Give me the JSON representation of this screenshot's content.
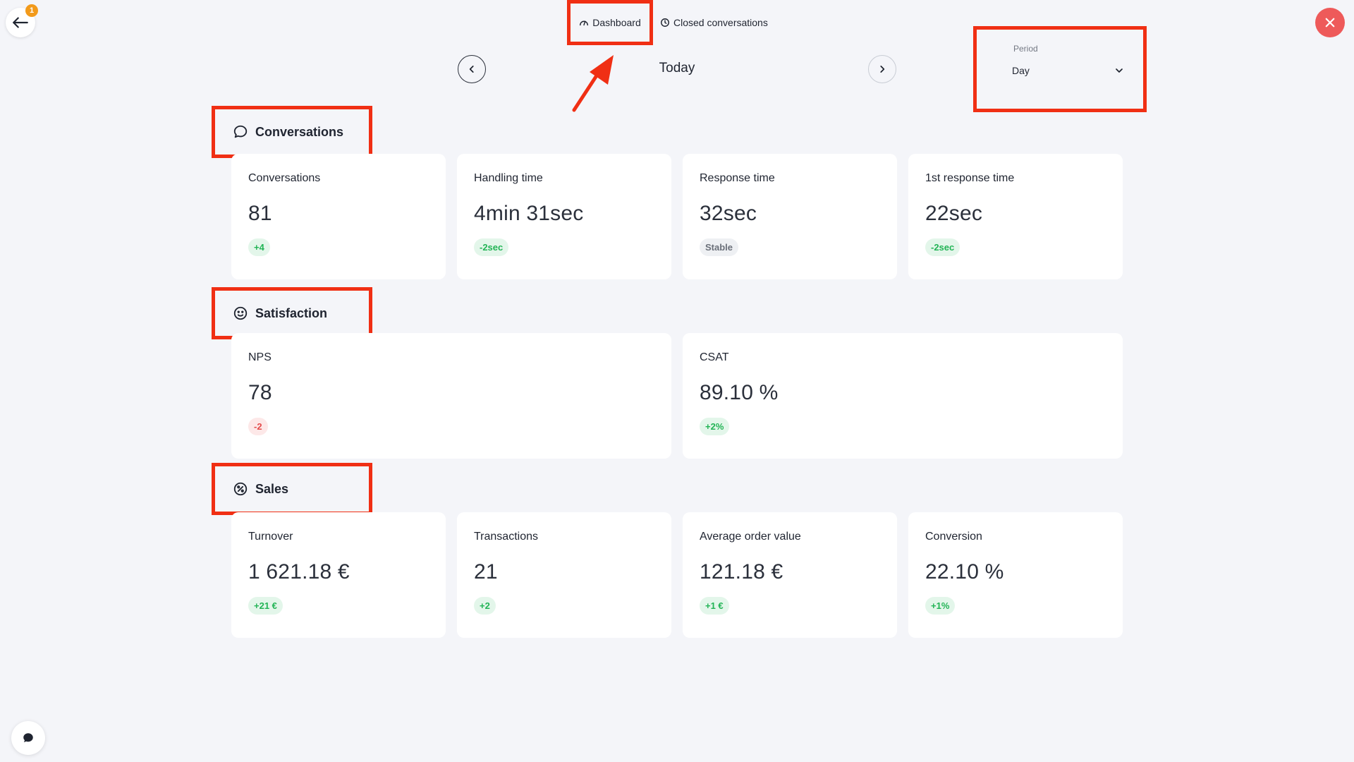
{
  "nav": {
    "notification_count": "1"
  },
  "tabs": [
    {
      "label": "Dashboard",
      "icon": "dashboard-gauge-icon",
      "active": true
    },
    {
      "label": "Closed conversations",
      "icon": "clock-icon",
      "active": false
    }
  ],
  "date_nav": {
    "label": "Today"
  },
  "period": {
    "label": "Period",
    "selected": "Day"
  },
  "sections": {
    "conversations": {
      "title": "Conversations",
      "icon": "chat-bubble-icon",
      "cards": [
        {
          "title": "Conversations",
          "value": "81",
          "delta": "+4",
          "trend": "positive"
        },
        {
          "title": "Handling time",
          "value": "4min 31sec",
          "delta": "-2sec",
          "trend": "positive"
        },
        {
          "title": "Response time",
          "value": "32sec",
          "delta": "Stable",
          "trend": "neutral"
        },
        {
          "title": "1st response time",
          "value": "22sec",
          "delta": "-2sec",
          "trend": "positive"
        }
      ]
    },
    "satisfaction": {
      "title": "Satisfaction",
      "icon": "smiley-icon",
      "cards": [
        {
          "title": "NPS",
          "value": "78",
          "delta": "-2",
          "trend": "negative"
        },
        {
          "title": "CSAT",
          "value": "89.10 %",
          "delta": "+2%",
          "trend": "positive"
        }
      ]
    },
    "sales": {
      "title": "Sales",
      "icon": "percent-icon",
      "cards": [
        {
          "title": "Turnover",
          "value": "1 621.18 €",
          "delta": "+21 €",
          "trend": "positive"
        },
        {
          "title": "Transactions",
          "value": "21",
          "delta": "+2",
          "trend": "positive"
        },
        {
          "title": "Average order value",
          "value": "121.18 €",
          "delta": "+1 €",
          "trend": "positive"
        },
        {
          "title": "Conversion",
          "value": "22.10 %",
          "delta": "+1%",
          "trend": "positive"
        }
      ]
    }
  },
  "colors": {
    "background": "#f4f5f9",
    "annotation_red": "#f02f14",
    "close_red": "#ee5a5a",
    "badge_orange": "#f29a1b",
    "positive_green": "#22b455",
    "negative_red": "#e44b4b"
  }
}
